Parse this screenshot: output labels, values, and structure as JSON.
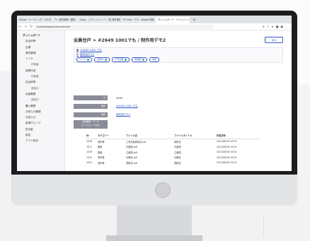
{
  "browser": {
    "tabs": [
      {
        "label": "GitLab・ミーティング・2022年9月・"
      },
      {
        "label": "アイ_案件管理（更新） - Google"
      },
      {
        "label": "スプレッドシート・新_案件管理表"
      },
      {
        "label": "PC map・デモ - Google 検索"
      },
      {
        "label": "ダッシュボード・ドキュメント管理",
        "active": true
      }
    ],
    "url": "localhost/applications/sample"
  },
  "sidebar": {
    "items": [
      {
        "label": "ダッシュボード",
        "kind": "group"
      },
      {
        "label": "自治体等",
        "kind": "item"
      },
      {
        "label": "企業",
        "kind": "item"
      },
      {
        "label": "案件管理",
        "kind": "item"
      },
      {
        "label": "トーク",
        "kind": "item"
      },
      {
        "label": "作成者",
        "kind": "sub"
      },
      {
        "label": "新規作成",
        "kind": "item"
      },
      {
        "label": "作成者",
        "kind": "sub"
      },
      {
        "label": "自治体等",
        "kind": "item"
      },
      {
        "label": "追加中",
        "kind": "sub"
      },
      {
        "label": "出版履歴",
        "kind": "item"
      },
      {
        "label": "追加中",
        "kind": "sub"
      },
      {
        "label": "購入履歴",
        "kind": "item"
      },
      {
        "label": "お知らせ管理",
        "kind": "item"
      },
      {
        "label": "お知らせ",
        "kind": "item"
      },
      {
        "label": "新規グループ",
        "kind": "item"
      },
      {
        "label": "担当者",
        "kind": "item"
      },
      {
        "label": "設定",
        "kind": "item"
      },
      {
        "label": "アプリ設定",
        "kind": "item"
      }
    ]
  },
  "main": {
    "title": "会員住戸 > #2649 1001でも / 制作用デモ2",
    "back_label": "戻る",
    "info": {
      "line1": "#2649 1001 でも",
      "line2": "制作用デモ2"
    },
    "chips": [
      {
        "label": "トーク"
      },
      {
        "label": "全体ID"
      },
      {
        "label": "デモ社員"
      },
      {
        "label": "申請者"
      },
      {
        "label": "未読"
      }
    ],
    "rows": [
      {
        "label": "ID",
        "value": "2649",
        "link": false
      },
      {
        "label": "物件",
        "value": "#2649 1001 でも",
        "link": true
      },
      {
        "label": "物件",
        "value": "制作用デモ2",
        "link": true
      }
    ],
    "files_label_line1": "交換書類・データ",
    "files_label_line2": "(アップロード済み)",
    "file_headers": [
      "ID",
      "カテゴリー",
      "ファイル名",
      "ファイルタイトル",
      "作成日時"
    ],
    "files": [
      [
        "1018",
        "資料等",
        "工事請負契約書.pdf",
        "契約書",
        "2021/08/16 19:01"
      ],
      [
        "1017",
        "図面",
        "平面図.pdf",
        "平面図",
        "2021/08/16 19:01"
      ],
      [
        "1016",
        "図面",
        "立面図.pdf",
        "立面図",
        "2021/08/16 19:01"
      ],
      [
        "1015",
        "資料等",
        "仕様書.pdf",
        "仕様書",
        "2021/08/16 19:01"
      ],
      [
        "1014",
        "資料等",
        "見積書.pdf",
        "見積書",
        "2021/08/16 19:01"
      ]
    ]
  }
}
